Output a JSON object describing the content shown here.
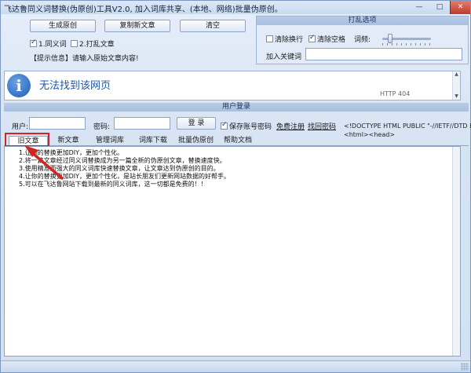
{
  "window": {
    "title": "飞达鲁同义词替换(伪原创)工具V2.0, 加入词库共享、(本地、网络)批量伪原创。",
    "min_glyph": "—",
    "max_glyph": "□",
    "close_glyph": "✕"
  },
  "toolbar": {
    "generate_label": "生成原创",
    "copy_label": "复制新文章",
    "clear_label": "清空",
    "synonym_label": "1.同义词",
    "shuffle_label": "2.打乱文章",
    "tip_text": "【提示信息】请输入原始文章内容!"
  },
  "options": {
    "title": "打乱选项",
    "clear_newline_label": "清除换行",
    "clear_space_label": "清除空格",
    "freq_label": "词频:",
    "keyword_label": "加入关键词",
    "keyword_value": "",
    "slider_level": 0.12
  },
  "browser": {
    "icon_glyph": "i",
    "error_title": "无法找到该网页",
    "error_code": "HTTP 404"
  },
  "login": {
    "section_title": "用户登录",
    "user_label": "用户:",
    "user_value": "",
    "pass_label": "密码:",
    "pass_value": "",
    "login_button": "登 录",
    "save_account_label": "保存账号密码",
    "register_link": "免费注册",
    "recover_link": "找回密码",
    "source_lines": [
      "<!DOCTYPE HTML PUBLIC \"-//IETF//DTD HTML 2",
      "<html><head>"
    ]
  },
  "tabs": [
    {
      "label": "旧文章"
    },
    {
      "label": "新文章"
    },
    {
      "label": "管理词库"
    },
    {
      "label": "词库下载"
    },
    {
      "label": "批量伪原创"
    },
    {
      "label": "帮助文档"
    }
  ],
  "editor": {
    "lines": [
      "1.让你的替换更加DIY，更加个性化。",
      "2.将一篇文章经过同义词替换成为另一篇全新的伪原创文章，替换速度快。",
      "3.使用精准而强大的同义词库快速替换文章，让文章达到伪原创的目的。",
      "4.让你的替换更加DIY，更加个性化，是站长朋友们更新网站数据的好帮手。",
      "5.可以在飞达鲁网站下载到最新的同义词库，这一切都是免费的！！"
    ]
  },
  "colors": {
    "highlight_box": "#d0261f",
    "accent": "#1d58a7"
  }
}
